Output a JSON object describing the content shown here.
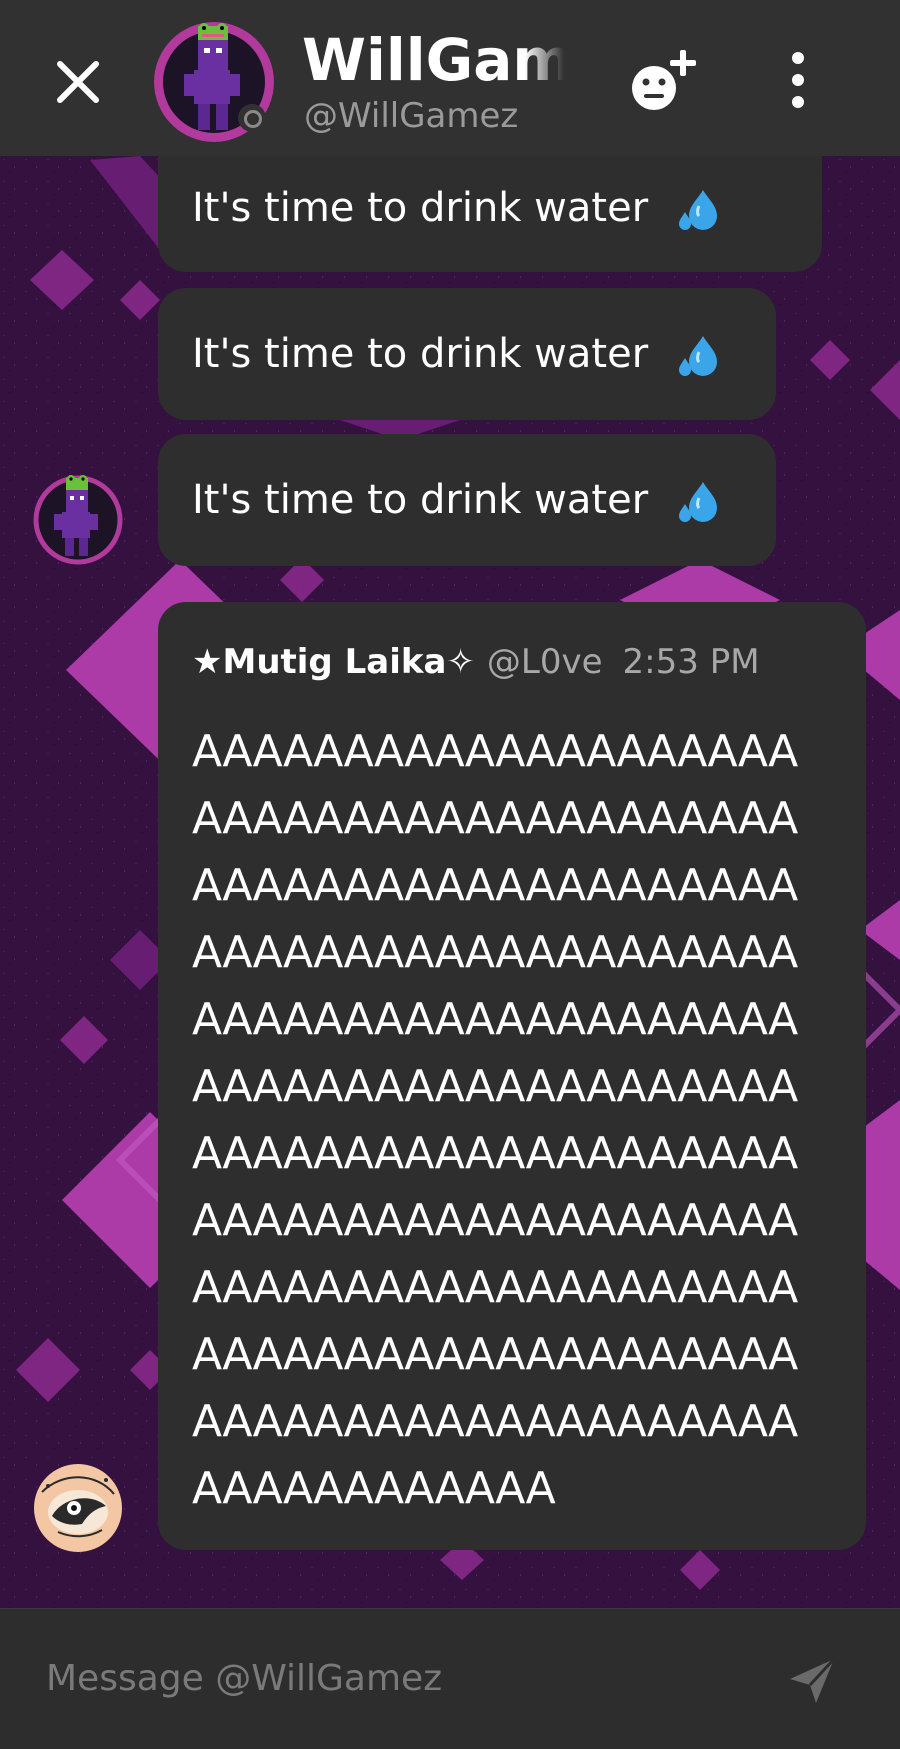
{
  "header": {
    "title": "WillGamez",
    "handle": "@WillGamez",
    "close_icon": "close-icon",
    "add_friend_icon": "add-friend-icon",
    "more_icon": "more-vertical-icon"
  },
  "messages": [
    {
      "text": "It's time to drink water",
      "emoji": "sweat-droplets-icon"
    },
    {
      "text": "It's time to drink water",
      "emoji": "sweat-droplets-icon"
    },
    {
      "text": "It's time to drink water",
      "emoji": "sweat-droplets-icon"
    }
  ],
  "embed": {
    "author": "★Mutig Laika✧",
    "handle": "@L0ve",
    "time": "2:53 PM",
    "lines": [
      "AAAAAAAAAAAAAAAAAAAA",
      "AAAAAAAAAAAAAAAAAAAA",
      "AAAAAAAAAAAAAAAAAAAA",
      "AAAAAAAAAAAAAAAAAAAA",
      "AAAAAAAAAAAAAAAAAAAA",
      "AAAAAAAAAAAAAAAAAAAA",
      "AAAAAAAAAAAAAAAAAAAA",
      "AAAAAAAAAAAAAAAAAAAA",
      "AAAAAAAAAAAAAAAAAAAA",
      "AAAAAAAAAAAAAAAAAAAA",
      "AAAAAAAAAAAAAAAAAAAA",
      "AAAAAAAAAAAA"
    ]
  },
  "composer": {
    "placeholder": "Message @WillGamez",
    "send_icon": "send-icon"
  },
  "colors": {
    "header_bg": "#313131",
    "bubble_bg": "#2e2e2e",
    "chat_bg": "#34113f",
    "accent_pink": "#b13a9c",
    "text_primary": "#ffffff",
    "text_secondary": "#9a9a9a"
  }
}
